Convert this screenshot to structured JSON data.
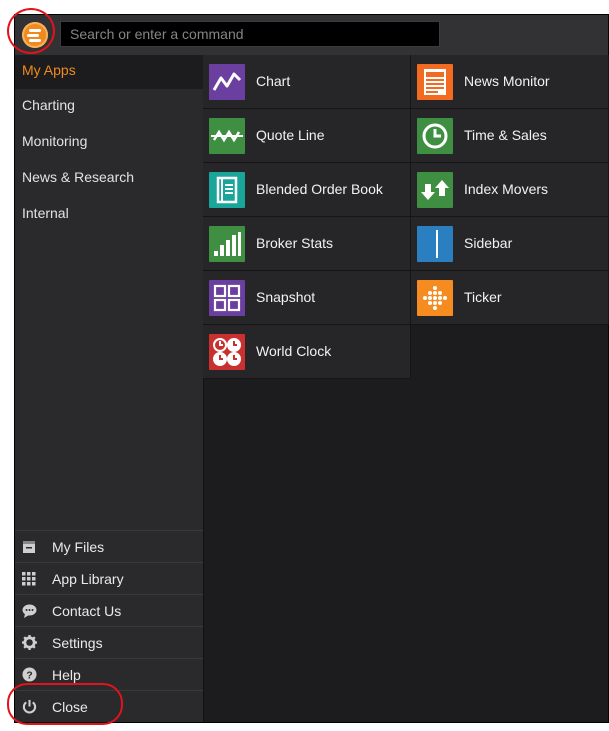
{
  "search": {
    "placeholder": "Search or enter a command"
  },
  "sidebar": {
    "categories": [
      {
        "label": "My Apps",
        "active": true
      },
      {
        "label": "Charting"
      },
      {
        "label": "Monitoring"
      },
      {
        "label": "News & Research"
      },
      {
        "label": "Internal"
      }
    ],
    "bottom_items": [
      {
        "label": "My Files",
        "icon": "folder-icon"
      },
      {
        "label": "App Library",
        "icon": "grid-icon"
      },
      {
        "label": "Contact Us",
        "icon": "chat-bubble-icon"
      },
      {
        "label": "Settings",
        "icon": "gear-icon"
      },
      {
        "label": "Help",
        "icon": "help-icon"
      },
      {
        "label": "Close",
        "icon": "power-icon"
      }
    ]
  },
  "apps": [
    {
      "label": "Chart",
      "icon": "chart-icon",
      "color": "#6b3fa0"
    },
    {
      "label": "News Monitor",
      "icon": "news-icon",
      "color": "#f26b21"
    },
    {
      "label": "Quote Line",
      "icon": "quote-line-icon",
      "color": "#3f8f43"
    },
    {
      "label": "Time & Sales",
      "icon": "clock-icon",
      "color": "#3f8f43"
    },
    {
      "label": "Blended Order Book",
      "icon": "book-icon",
      "color": "#1aa59a"
    },
    {
      "label": "Index Movers",
      "icon": "arrows-icon",
      "color": "#3f8f43"
    },
    {
      "label": "Broker Stats",
      "icon": "bar-chart-icon",
      "color": "#3f8f43"
    },
    {
      "label": "Sidebar",
      "icon": "sidebar-icon",
      "color": "#2a7fc1"
    },
    {
      "label": "Snapshot",
      "icon": "snapshot-icon",
      "color": "#6b3fa0"
    },
    {
      "label": "Ticker",
      "icon": "ticker-icon",
      "color": "#f68b1f"
    },
    {
      "label": "World Clock",
      "icon": "world-clock-icon",
      "color": "#c8312f"
    }
  ]
}
